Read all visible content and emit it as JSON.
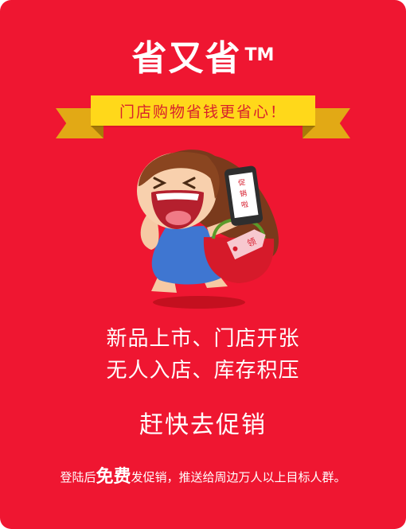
{
  "brand": {
    "title": "省又省",
    "trademark": "TM"
  },
  "ribbon": {
    "text": "门店购物省钱更省心！"
  },
  "mascot": {
    "phone_text": "促销啦",
    "tag_text": "领"
  },
  "headline": {
    "line1": "新品上市、门店开张",
    "line2": "无人入店、库存积压"
  },
  "cta": {
    "text": "赶快去促销"
  },
  "footer": {
    "prefix": "登陆后",
    "highlight": "免费",
    "suffix": "发促销，推送给周边万人以上目标人群。"
  },
  "colors": {
    "background": "#ef1631",
    "ribbon": "#ffd81a",
    "ribbon_text": "#d8202c",
    "text": "#ffffff"
  }
}
